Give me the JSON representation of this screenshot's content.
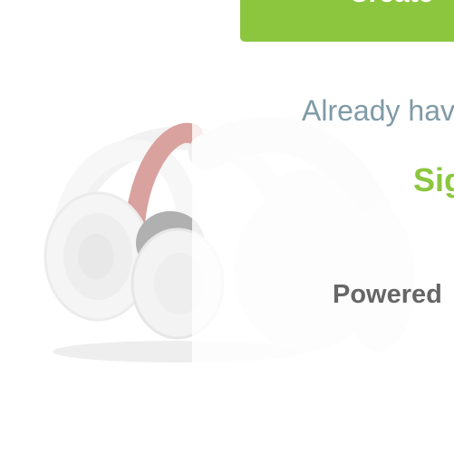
{
  "signup": {
    "create_button_label": "Create"
  },
  "login_prompt": {
    "already_text": "Already have",
    "signin_label": "Sig"
  },
  "footer": {
    "powered_text": "Powered"
  },
  "colors": {
    "accent_green": "#8cc63f",
    "muted_blue_gray": "#7f9aa6",
    "dark_gray": "#666666"
  },
  "icons": {
    "product": "headphones-image"
  }
}
